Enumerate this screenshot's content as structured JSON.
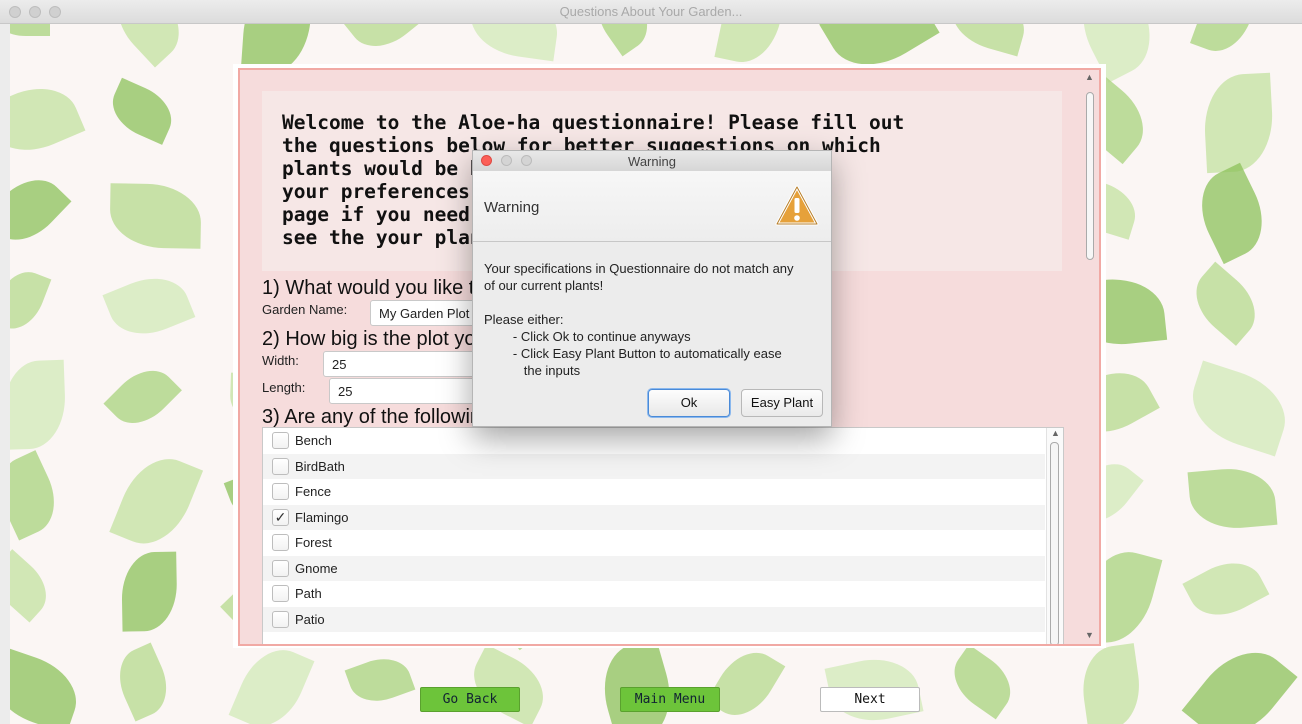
{
  "window": {
    "title": "Questions About Your Garden..."
  },
  "welcome_text": "Welcome to the Aloe-ha questionnaire! Please fill out\nthe questions below for better suggestions on which\nplants would be best suited for\nyour preferences. You can also go back to this\npage if you need to. Press 'Next' to\nsee the your plan.",
  "questions": {
    "q1": "1) What would you like to name your garden?",
    "garden_name_label": "Garden Name:",
    "garden_name_value": "My Garden Plot",
    "q2": "2) How big is the plot you are working with?",
    "width_label": "Width:",
    "width_value": "25",
    "length_label": "Length:",
    "length_value": "25",
    "q3": "3) Are any of the following in your garden? (select all that apply)"
  },
  "features": [
    {
      "label": "Bench",
      "checked": false
    },
    {
      "label": "BirdBath",
      "checked": false
    },
    {
      "label": "Fence",
      "checked": false
    },
    {
      "label": "Flamingo",
      "checked": true
    },
    {
      "label": "Forest",
      "checked": false
    },
    {
      "label": "Gnome",
      "checked": false
    },
    {
      "label": "Path",
      "checked": false
    },
    {
      "label": "Patio",
      "checked": false
    }
  ],
  "buttons": {
    "back": "Go Back",
    "main_menu": "Main Menu",
    "next": "Next"
  },
  "dialog": {
    "title": "Warning",
    "header": "Warning",
    "message_lines": [
      "Your specifications in Questionnaire do not match any",
      "of our current plants!",
      "",
      "Please either:",
      "        - Click Ok to continue anyways",
      "        - Click Easy Plant Button to automatically ease",
      "           the inputs"
    ],
    "ok_label": "Ok",
    "easy_label": "Easy Plant"
  },
  "colors": {
    "panel_border": "#f1a9a4",
    "panel_bg": "#f6dcdc",
    "green_button": "#6dc43a",
    "leaf": "#9ccb6b"
  },
  "icons": [
    "warning-icon",
    "checkmark-icon"
  ]
}
